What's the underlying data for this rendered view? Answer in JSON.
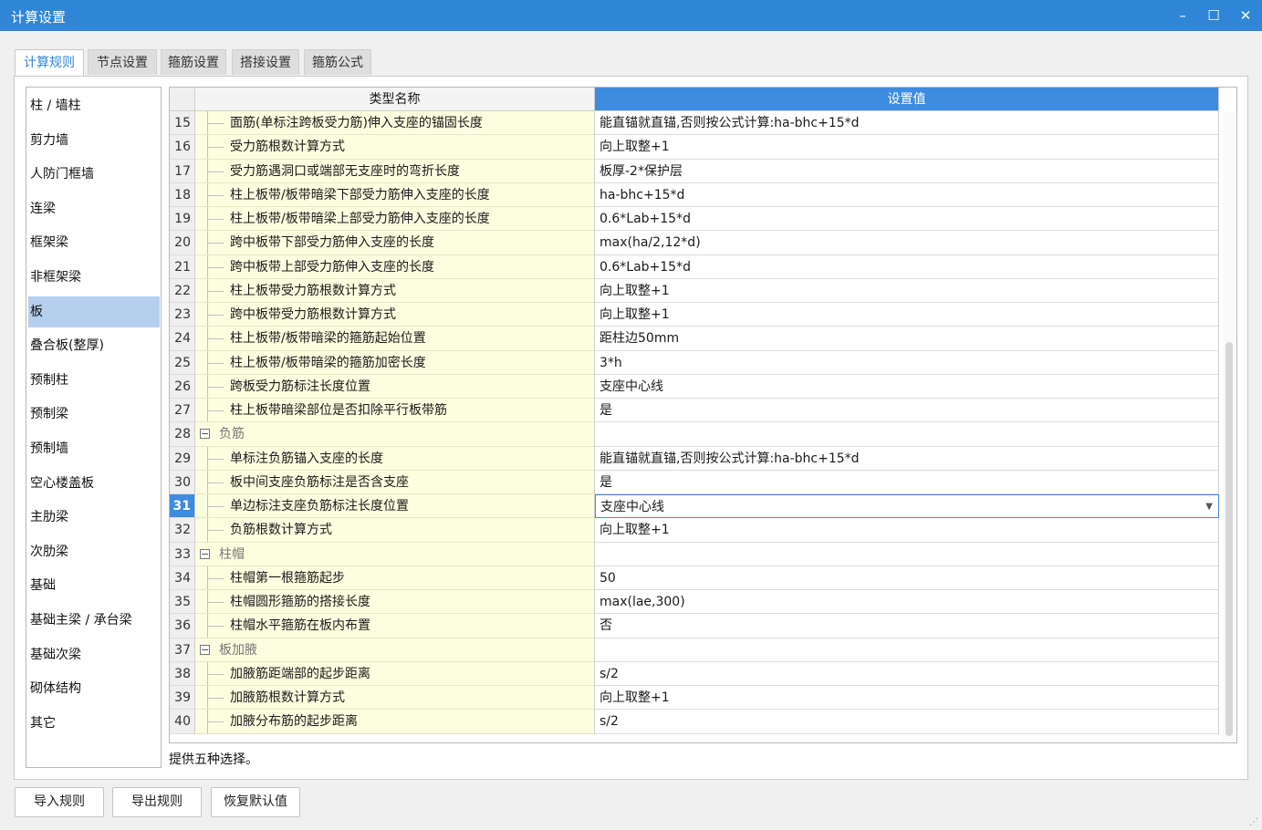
{
  "window": {
    "title": "计算设置",
    "minimize": "–",
    "maximize": "☐",
    "close": "✕"
  },
  "tabs": [
    "计算规则",
    "节点设置",
    "箍筋设置",
    "搭接设置",
    "箍筋公式"
  ],
  "sidebar": [
    "柱 / 墙柱",
    "剪力墙",
    "人防门框墙",
    "连梁",
    "框架梁",
    "非框架梁",
    "板",
    "叠合板(整厚)",
    "预制柱",
    "预制梁",
    "预制墙",
    "空心楼盖板",
    "主肋梁",
    "次肋梁",
    "基础",
    "基础主梁 / 承台梁",
    "基础次梁",
    "砌体结构",
    "其它"
  ],
  "grid": {
    "col_name": "类型名称",
    "col_value": "设置值",
    "rows": [
      {
        "n": "15",
        "name": "面筋(单标注跨板受力筋)伸入支座的锚固长度",
        "value": "能直锚就直锚,否则按公式计算:ha-bhc+15*d"
      },
      {
        "n": "16",
        "name": "受力筋根数计算方式",
        "value": "向上取整+1"
      },
      {
        "n": "17",
        "name": "受力筋遇洞口或端部无支座时的弯折长度",
        "value": "板厚-2*保护层"
      },
      {
        "n": "18",
        "name": "柱上板带/板带暗梁下部受力筋伸入支座的长度",
        "value": "ha-bhc+15*d"
      },
      {
        "n": "19",
        "name": "柱上板带/板带暗梁上部受力筋伸入支座的长度",
        "value": "0.6*Lab+15*d"
      },
      {
        "n": "20",
        "name": "跨中板带下部受力筋伸入支座的长度",
        "value": "max(ha/2,12*d)"
      },
      {
        "n": "21",
        "name": "跨中板带上部受力筋伸入支座的长度",
        "value": "0.6*Lab+15*d"
      },
      {
        "n": "22",
        "name": "柱上板带受力筋根数计算方式",
        "value": "向上取整+1"
      },
      {
        "n": "23",
        "name": "跨中板带受力筋根数计算方式",
        "value": "向上取整+1"
      },
      {
        "n": "24",
        "name": "柱上板带/板带暗梁的箍筋起始位置",
        "value": "距柱边50mm"
      },
      {
        "n": "25",
        "name": "柱上板带/板带暗梁的箍筋加密长度",
        "value": "3*h"
      },
      {
        "n": "26",
        "name": "跨板受力筋标注长度位置",
        "value": "支座中心线"
      },
      {
        "n": "27",
        "name": "柱上板带暗梁部位是否扣除平行板带筋",
        "value": "是"
      },
      {
        "n": "28",
        "name": "负筋",
        "value": "",
        "group": true
      },
      {
        "n": "29",
        "name": "单标注负筋锚入支座的长度",
        "value": "能直锚就直锚,否则按公式计算:ha-bhc+15*d"
      },
      {
        "n": "30",
        "name": "板中间支座负筋标注是否含支座",
        "value": "是"
      },
      {
        "n": "31",
        "name": "单边标注支座负筋标注长度位置",
        "value": "支座中心线",
        "current": true
      },
      {
        "n": "32",
        "name": "负筋根数计算方式",
        "value": "向上取整+1"
      },
      {
        "n": "33",
        "name": "柱帽",
        "value": "",
        "group": true
      },
      {
        "n": "34",
        "name": "柱帽第一根箍筋起步",
        "value": "50"
      },
      {
        "n": "35",
        "name": "柱帽圆形箍筋的搭接长度",
        "value": "max(lae,300)"
      },
      {
        "n": "36",
        "name": "柱帽水平箍筋在板内布置",
        "value": "否"
      },
      {
        "n": "37",
        "name": "板加腋",
        "value": "",
        "group": true
      },
      {
        "n": "38",
        "name": "加腋筋距端部的起步距离",
        "value": "s/2"
      },
      {
        "n": "39",
        "name": "加腋筋根数计算方式",
        "value": "向上取整+1"
      },
      {
        "n": "40",
        "name": "加腋分布筋的起步距离",
        "value": "s/2"
      }
    ]
  },
  "description": "提供五种选择。",
  "buttons": {
    "import": "导入规则",
    "export": "导出规则",
    "reset": "恢复默认值"
  },
  "colors": {
    "titlebar": "#2f86d6",
    "header_value": "#3d8ce0",
    "name_cell": "#fdfde0",
    "selected_item": "#b6cfee"
  }
}
